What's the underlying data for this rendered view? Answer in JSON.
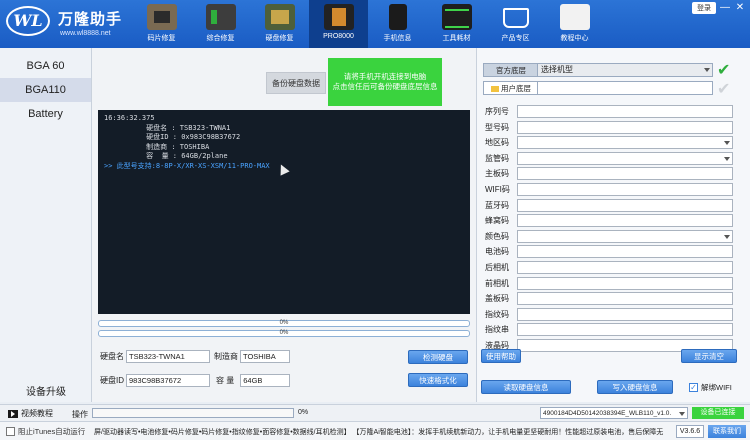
{
  "brand": {
    "logo_text": "WL",
    "name": "万隆助手",
    "url": "www.wl8888.net"
  },
  "nav": [
    {
      "label": "码片修复",
      "icon": "chip-icon"
    },
    {
      "label": "综合修复",
      "icon": "repair-tools-icon"
    },
    {
      "label": "硬盘修复",
      "icon": "hard-drive-board-icon"
    },
    {
      "label": "PRO8000",
      "icon": "programmer-icon"
    },
    {
      "label": "手机信息",
      "icon": "phone-icon"
    },
    {
      "label": "工具耗材",
      "icon": "oscilloscope-icon"
    },
    {
      "label": "产品专区",
      "icon": "shopping-cart-icon"
    },
    {
      "label": "教程中心",
      "icon": "book-icon"
    }
  ],
  "window": {
    "login": "登录",
    "minimize": "—",
    "close": "✕"
  },
  "sidebar": {
    "items": [
      {
        "label": "BGA 60"
      },
      {
        "label": "BGA110"
      },
      {
        "label": "Battery"
      }
    ],
    "upgrade": "设备升级"
  },
  "center": {
    "backup_button": "备份硬盘数据",
    "notice_line1": "请将手机开机连接到电脑",
    "notice_line2": "点击信任后可备份硬盘底层信息",
    "terminal": {
      "time": "16:36:32.375",
      "lines": [
        "          硬盘名 : TSB323-TWNA1",
        "          硬盘ID : 0x983C98B37672",
        "          制造商 : TOSHIBA",
        "          容  量 : 64GB/2plane"
      ],
      "support_line": ">> 此型号支持:8-8P-X/XR-XS-XSM/11-PRO-MAX"
    },
    "progress1": "0%",
    "progress2": "0%",
    "disk_name_label": "硬盘名",
    "disk_name_value": "TSB323-TWNA1",
    "maker_label": "制造商",
    "maker_value": "TOSHIBA",
    "disk_id_label": "硬盘ID",
    "disk_id_value": "983C98B37672",
    "capacity_label": "容 量",
    "capacity_value": "64GB",
    "detect_button": "检测硬盘",
    "format_button": "快速格式化"
  },
  "right": {
    "official_tab": "官方底层",
    "user_tab": "用户底层",
    "model_select": "选择机型",
    "fields": [
      {
        "label": "序列号",
        "dropdown": false
      },
      {
        "label": "型号码",
        "dropdown": false
      },
      {
        "label": "地区码",
        "dropdown": true
      },
      {
        "label": "监管码",
        "dropdown": true
      },
      {
        "label": "主板码",
        "dropdown": false
      },
      {
        "label": "WIFI码",
        "dropdown": false
      },
      {
        "label": "蓝牙码",
        "dropdown": false
      },
      {
        "label": "蜂窝码",
        "dropdown": false
      },
      {
        "label": "颜色码",
        "dropdown": true
      },
      {
        "label": "电池码",
        "dropdown": false
      },
      {
        "label": "后相机",
        "dropdown": false
      },
      {
        "label": "前相机",
        "dropdown": false
      },
      {
        "label": "盖板码",
        "dropdown": false
      },
      {
        "label": "指纹码",
        "dropdown": false
      },
      {
        "label": "指纹串",
        "dropdown": false
      },
      {
        "label": "液晶码",
        "dropdown": false
      }
    ],
    "help_button": "使用帮助",
    "clear_button": "显示清空",
    "read_button": "读取硬盘信息",
    "write_button": "写入硬盘信息",
    "unbind_label": "解绑WIFI"
  },
  "status": {
    "tutorial": "视频教程",
    "operation": "操作",
    "percent": "0%",
    "serial": "4900184D4D50142038394E_WLB110_v1.0.",
    "done": "设备已连接"
  },
  "footer": {
    "itunes": "阻止iTunes自动运行",
    "ticker": "屏/驱动器读写•电池修复•码片修复•码片修复•指纹修复•面容修复•数据线/耳机检测】  【万隆Ai智能电池】：发挥手机续航新动力，让手机电量更坚硬耐用！性能超过原装电池，售后保障无",
    "version": "V3.6.6",
    "contact": "联系我们"
  }
}
